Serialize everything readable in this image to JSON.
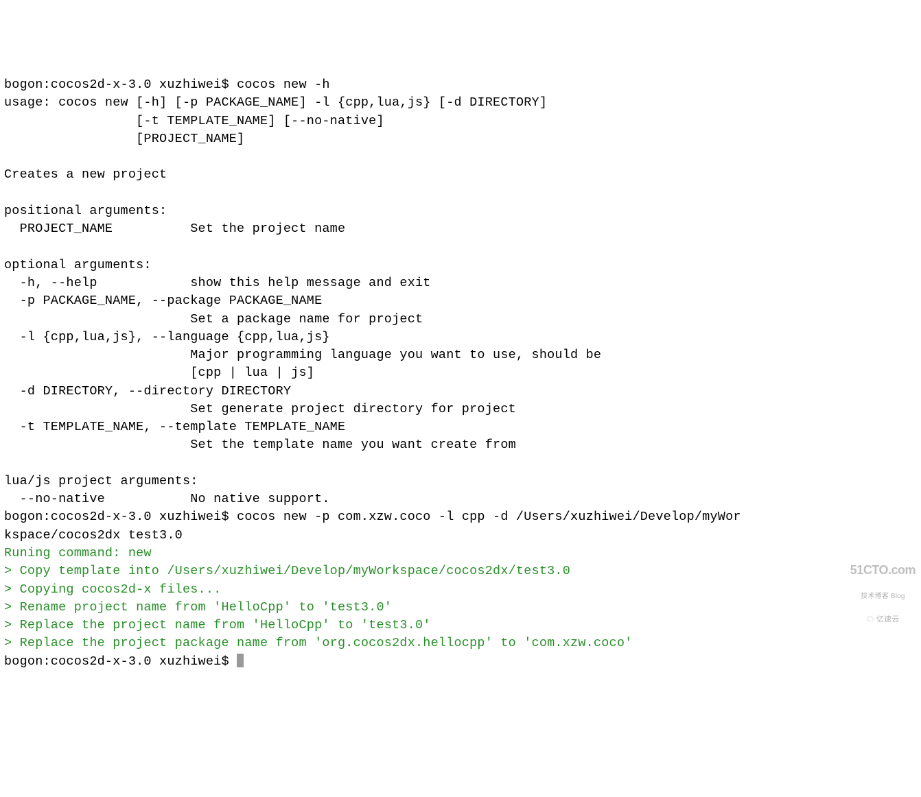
{
  "prompt1_prefix": "bogon:cocos2d-x-3.0 xuzhiwei$ ",
  "cmd1": "cocos new -h",
  "usage_line1": "usage: cocos new [-h] [-p PACKAGE_NAME] -l {cpp,lua,js} [-d DIRECTORY]",
  "usage_line2": "                 [-t TEMPLATE_NAME] [--no-native]",
  "usage_line3": "                 [PROJECT_NAME]",
  "desc": "Creates a new project",
  "positional_header": "positional arguments:",
  "pos_project_name": "  PROJECT_NAME          Set the project name",
  "optional_header": "optional arguments:",
  "opt_h": "  -h, --help            show this help message and exit",
  "opt_p1": "  -p PACKAGE_NAME, --package PACKAGE_NAME",
  "opt_p2": "                        Set a package name for project",
  "opt_l1": "  -l {cpp,lua,js}, --language {cpp,lua,js}",
  "opt_l2": "                        Major programming language you want to use, should be",
  "opt_l3": "                        [cpp | lua | js]",
  "opt_d1": "  -d DIRECTORY, --directory DIRECTORY",
  "opt_d2": "                        Set generate project directory for project",
  "opt_t1": "  -t TEMPLATE_NAME, --template TEMPLATE_NAME",
  "opt_t2": "                        Set the template name you want create from",
  "luajs_header": "lua/js project arguments:",
  "luajs_nonative": "  --no-native           No native support.",
  "prompt2_prefix": "bogon:cocos2d-x-3.0 xuzhiwei$ ",
  "cmd2_part1": "cocos new -p com.xzw.coco -l cpp -d /Users/xuzhiwei/Develop/myWor",
  "cmd2_part2": "kspace/cocos2dx test3.0",
  "out_run": "Runing command: new",
  "out_copy_template": "> Copy template into /Users/xuzhiwei/Develop/myWorkspace/cocos2dx/test3.0",
  "out_copy_files": "> Copying cocos2d-x files...",
  "out_rename": "> Rename project name from 'HelloCpp' to 'test3.0'",
  "out_replace_name": "> Replace the project name from 'HelloCpp' to 'test3.0'",
  "out_replace_pkg": "> Replace the project package name from 'org.cocos2dx.hellocpp' to 'com.xzw.coco'",
  "prompt3": "bogon:cocos2d-x-3.0 xuzhiwei$ ",
  "watermark_big": "51CTO.com",
  "watermark_mid": "技术博客 Blog",
  "watermark_small": "亿速云"
}
